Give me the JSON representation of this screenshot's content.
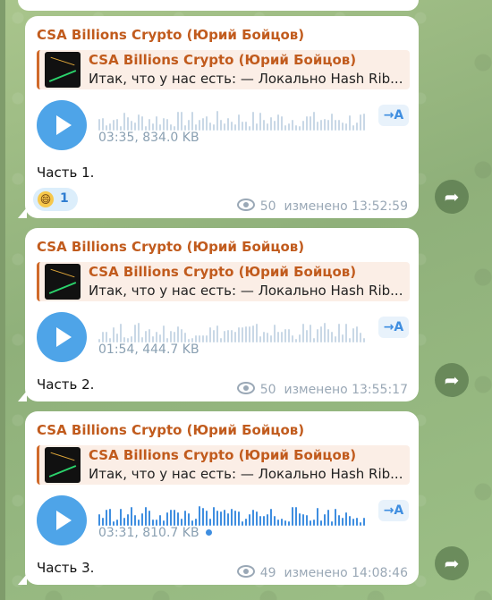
{
  "messages": [
    {
      "sender": "CSA Billions Crypto (Юрий Бойцов)",
      "reply_title": "CSA Billions Crypto (Юрий Бойцов)",
      "reply_text": "Итак, что у нас есть:  — Локально Hash Rib...",
      "transcribe_label": "→A",
      "voice_meta": "03:35, 834.0 KB",
      "caption": "Часть 1.",
      "reaction_emoji": "😄",
      "reaction_count": "1",
      "views": "50",
      "edited_time": "изменено 13:52:59",
      "played": true,
      "unread_dot": false
    },
    {
      "sender": "CSA Billions Crypto (Юрий Бойцов)",
      "reply_title": "CSA Billions Crypto (Юрий Бойцов)",
      "reply_text": "Итак, что у нас есть:  — Локально Hash Rib...",
      "transcribe_label": "→A",
      "voice_meta": "01:54, 444.7 KB",
      "caption": "Часть 2.",
      "views": "50",
      "edited_time": "изменено 13:55:17",
      "played": true,
      "unread_dot": false
    },
    {
      "sender": "CSA Billions Crypto (Юрий Бойцов)",
      "reply_title": "CSA Billions Crypto (Юрий Бойцов)",
      "reply_text": "Итак, что у нас есть:  — Локально Hash Rib...",
      "transcribe_label": "→A",
      "voice_meta": "03:31, 810.7 KB",
      "caption": "Часть 3.",
      "views": "49",
      "edited_time": "изменено 14:08:46",
      "played": false,
      "unread_dot": true
    }
  ],
  "icons": {
    "play": "play-icon",
    "views": "eye-icon",
    "share": "share-icon",
    "transcribe": "transcribe-icon"
  },
  "colors": {
    "accent": "#4ea4e8",
    "sender": "#c15b1d",
    "waveform_played": "#c9d8e6",
    "waveform_unplayed": "#3f8ee0"
  }
}
